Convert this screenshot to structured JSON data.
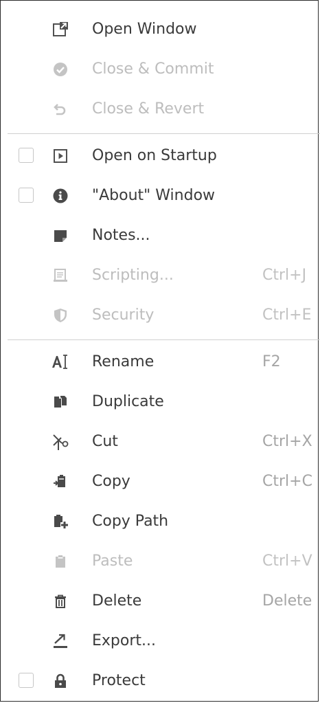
{
  "menu": {
    "open_window": {
      "label": "Open Window",
      "icon": "open-window-icon"
    },
    "close_commit": {
      "label": "Close & Commit",
      "icon": "check-circle-icon"
    },
    "close_revert": {
      "label": "Close & Revert",
      "icon": "undo-icon"
    },
    "open_on_startup": {
      "label": "Open on Startup",
      "icon": "play-square-icon",
      "checked": false
    },
    "about_window": {
      "label": "\"About\" Window",
      "icon": "info-circle-icon",
      "checked": false
    },
    "notes": {
      "label": "Notes...",
      "icon": "sticky-note-icon"
    },
    "scripting": {
      "label": "Scripting...",
      "shortcut": "Ctrl+J",
      "icon": "script-icon"
    },
    "security": {
      "label": "Security",
      "shortcut": "Ctrl+E",
      "icon": "shield-icon"
    },
    "rename": {
      "label": "Rename",
      "shortcut": "F2",
      "icon": "text-cursor-icon"
    },
    "duplicate": {
      "label": "Duplicate",
      "icon": "duplicate-icon"
    },
    "cut": {
      "label": "Cut",
      "shortcut": "Ctrl+X",
      "icon": "scissors-icon"
    },
    "copy": {
      "label": "Copy",
      "shortcut": "Ctrl+C",
      "icon": "copy-icon"
    },
    "copy_path": {
      "label": "Copy Path",
      "icon": "copy-path-icon"
    },
    "paste": {
      "label": "Paste",
      "shortcut": "Ctrl+V",
      "icon": "clipboard-icon"
    },
    "delete": {
      "label": "Delete",
      "shortcut": "Delete",
      "icon": "trash-icon"
    },
    "export": {
      "label": "Export...",
      "icon": "export-icon"
    },
    "protect": {
      "label": "Protect",
      "icon": "lock-icon",
      "checked": false
    }
  },
  "colors": {
    "text": "#3a3a3a",
    "disabled_text": "#bdbdbd",
    "icon": "#505050",
    "disabled_icon": "#c4c4c4",
    "border": "#2b2b2b"
  }
}
